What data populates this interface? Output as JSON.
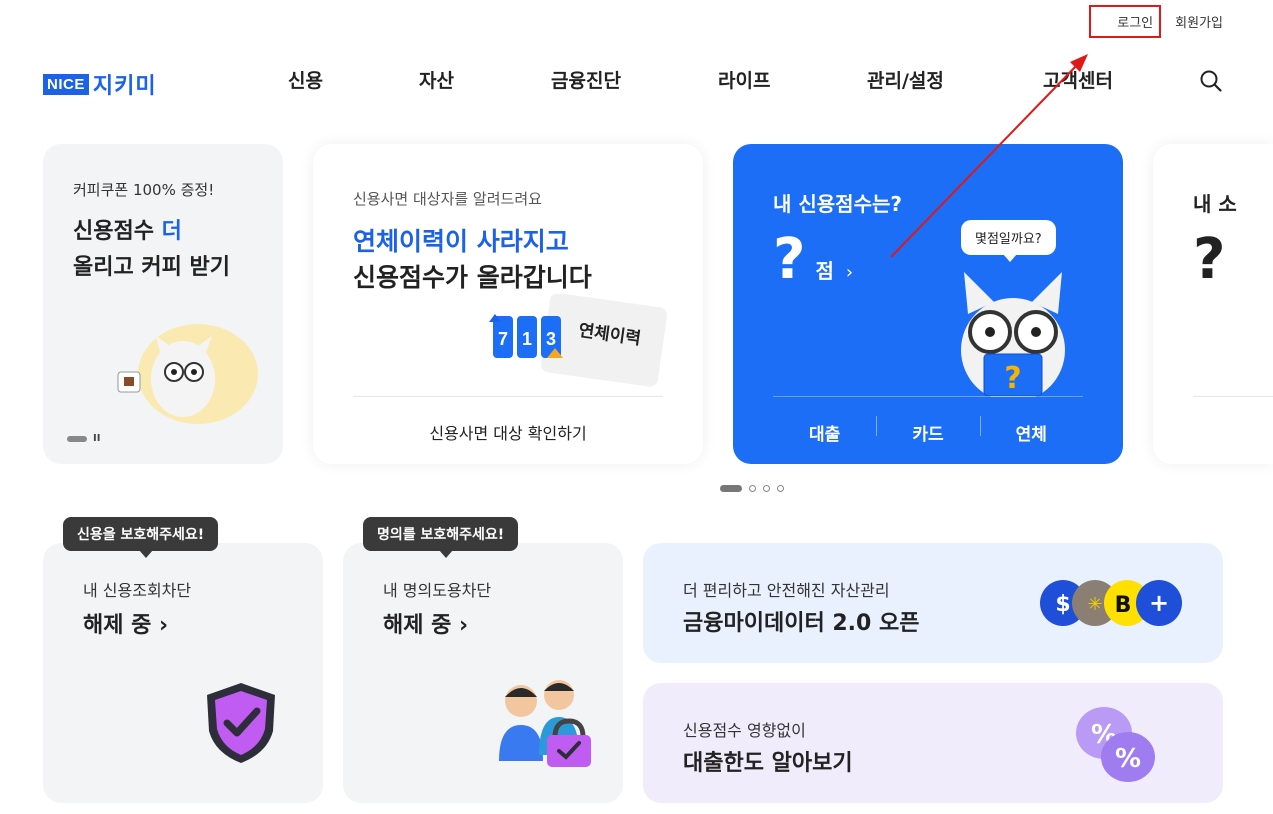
{
  "util": {
    "login": "로그인",
    "signup": "회원가입"
  },
  "logo": {
    "badge": "NICE",
    "brand": "지키미"
  },
  "nav": [
    "신용",
    "자산",
    "금융진단",
    "라이프",
    "관리/설정",
    "고객센터"
  ],
  "carousel": {
    "card1": {
      "sub": "커피쿠폰 100% 증정!",
      "title_a": "신용점수 ",
      "title_hl": "더",
      "title_b": "올리고 커피 받기",
      "pause": "II"
    },
    "card2": {
      "sub": "신용사면 대상자를 알려드려요",
      "title1": "연체이력이 사라지고",
      "title2": "신용점수가 올라갑니다",
      "cta": "신용사면 대상 확인하기",
      "art_label": "연체이력",
      "art_digits": [
        "7",
        "1",
        "3"
      ]
    },
    "card3": {
      "title": "내 신용점수는?",
      "score": "?",
      "unit": "점",
      "arrow": "›",
      "bubble": "몇점일까요?",
      "tabs": [
        "대출",
        "카드",
        "연체"
      ],
      "mascot_mark": "?"
    },
    "card4": {
      "title": "내 소",
      "score": "?"
    }
  },
  "tiles": {
    "block_credit": {
      "tip": "신용을 보호해주세요!",
      "label": "내 신용조회차단",
      "value": "해제 중 ›"
    },
    "block_identity": {
      "tip": "명의를 보호해주세요!",
      "label": "내 명의도용차단",
      "value": "해제 중 ›"
    },
    "mydata": {
      "label": "더 편리하고 안전해진 자산관리",
      "value": "금융마이데이터 2.0 오픈"
    },
    "loan": {
      "label": "신용점수 영향없이",
      "value": "대출한도 알아보기"
    }
  },
  "colors": {
    "brand": "#1b62e6",
    "card_blue": "#1b6ef5",
    "annotation": "#e01818"
  }
}
